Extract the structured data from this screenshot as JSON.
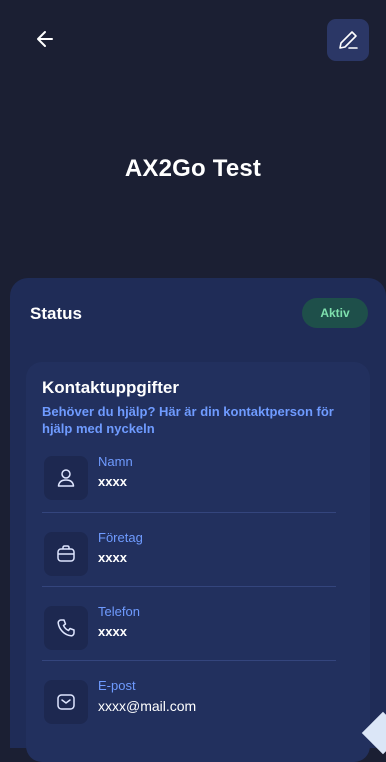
{
  "header": {
    "back_icon": "arrow-left-icon",
    "edit_icon": "pencil-icon",
    "title": "AX2Go Test"
  },
  "status": {
    "label": "Status",
    "badge": "Aktiv",
    "badge_color": "#7ee0ad"
  },
  "contact": {
    "title": "Kontaktuppgifter",
    "subtitle": "Behöver du hjälp? Här är din kontaktperson för hjälp med nyckeln",
    "fields": [
      {
        "icon": "person-icon",
        "label": "Namn",
        "value": "xxxx"
      },
      {
        "icon": "briefcase-icon",
        "label": "Företag",
        "value": "xxxx"
      },
      {
        "icon": "phone-icon",
        "label": "Telefon",
        "value": "xxxx"
      },
      {
        "icon": "mail-icon",
        "label": "E-post",
        "value": "xxxx@mail.com"
      }
    ]
  },
  "colors": {
    "background": "#1b1f33",
    "sheet": "#1f2c57",
    "card": "#22305e",
    "accent": "#6f9bff"
  }
}
